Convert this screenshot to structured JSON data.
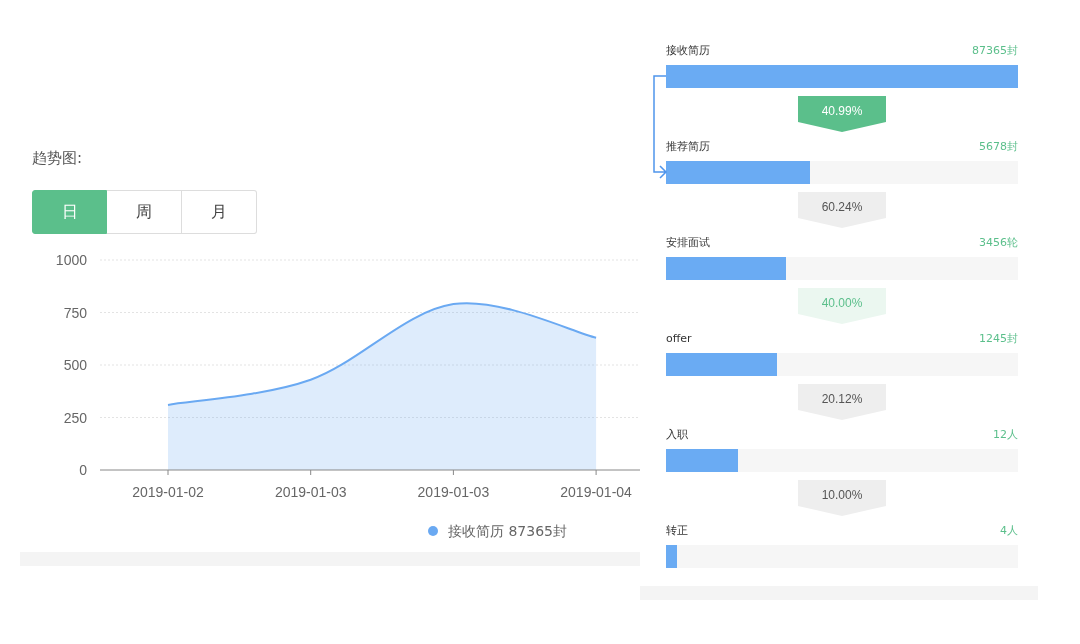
{
  "trend": {
    "title": "趋势图:",
    "tabs": [
      {
        "label": "日",
        "selected": true
      },
      {
        "label": "周",
        "selected": false
      },
      {
        "label": "月",
        "selected": false
      }
    ],
    "chart_data": {
      "type": "area",
      "categories": [
        "2019-01-02",
        "2019-01-03",
        "2019-01-03",
        "2019-01-04"
      ],
      "ylim": [
        0,
        1000
      ],
      "grid": true,
      "yticks": [
        0,
        250,
        500,
        750,
        1000
      ],
      "series": [
        {
          "name": "接收简历 87365封",
          "color": "#6aa9f2",
          "values": [
            310,
            430,
            790,
            630
          ]
        }
      ]
    }
  },
  "funnel": {
    "stages": [
      {
        "label": "接收简历",
        "count": "87365封",
        "level": 1.0,
        "rate": {
          "text": "40.99%",
          "kind": "highlight"
        }
      },
      {
        "label": "推荐简历",
        "count": "5678封",
        "level": 0.41,
        "rate": {
          "text": "60.24%",
          "kind": "plain"
        }
      },
      {
        "label": "安排面试",
        "count": "3456轮",
        "level": 0.34,
        "rate": {
          "text": "40.00%",
          "kind": "soft"
        }
      },
      {
        "label": "offer",
        "count": "1245封",
        "level": 0.315,
        "rate": {
          "text": "20.12%",
          "kind": "plain"
        }
      },
      {
        "label": "入职",
        "count": "12人",
        "level": 0.205,
        "rate": {
          "text": "10.00%",
          "kind": "plain"
        }
      },
      {
        "label": "转正",
        "count": "4人",
        "level": 0.03
      }
    ]
  }
}
